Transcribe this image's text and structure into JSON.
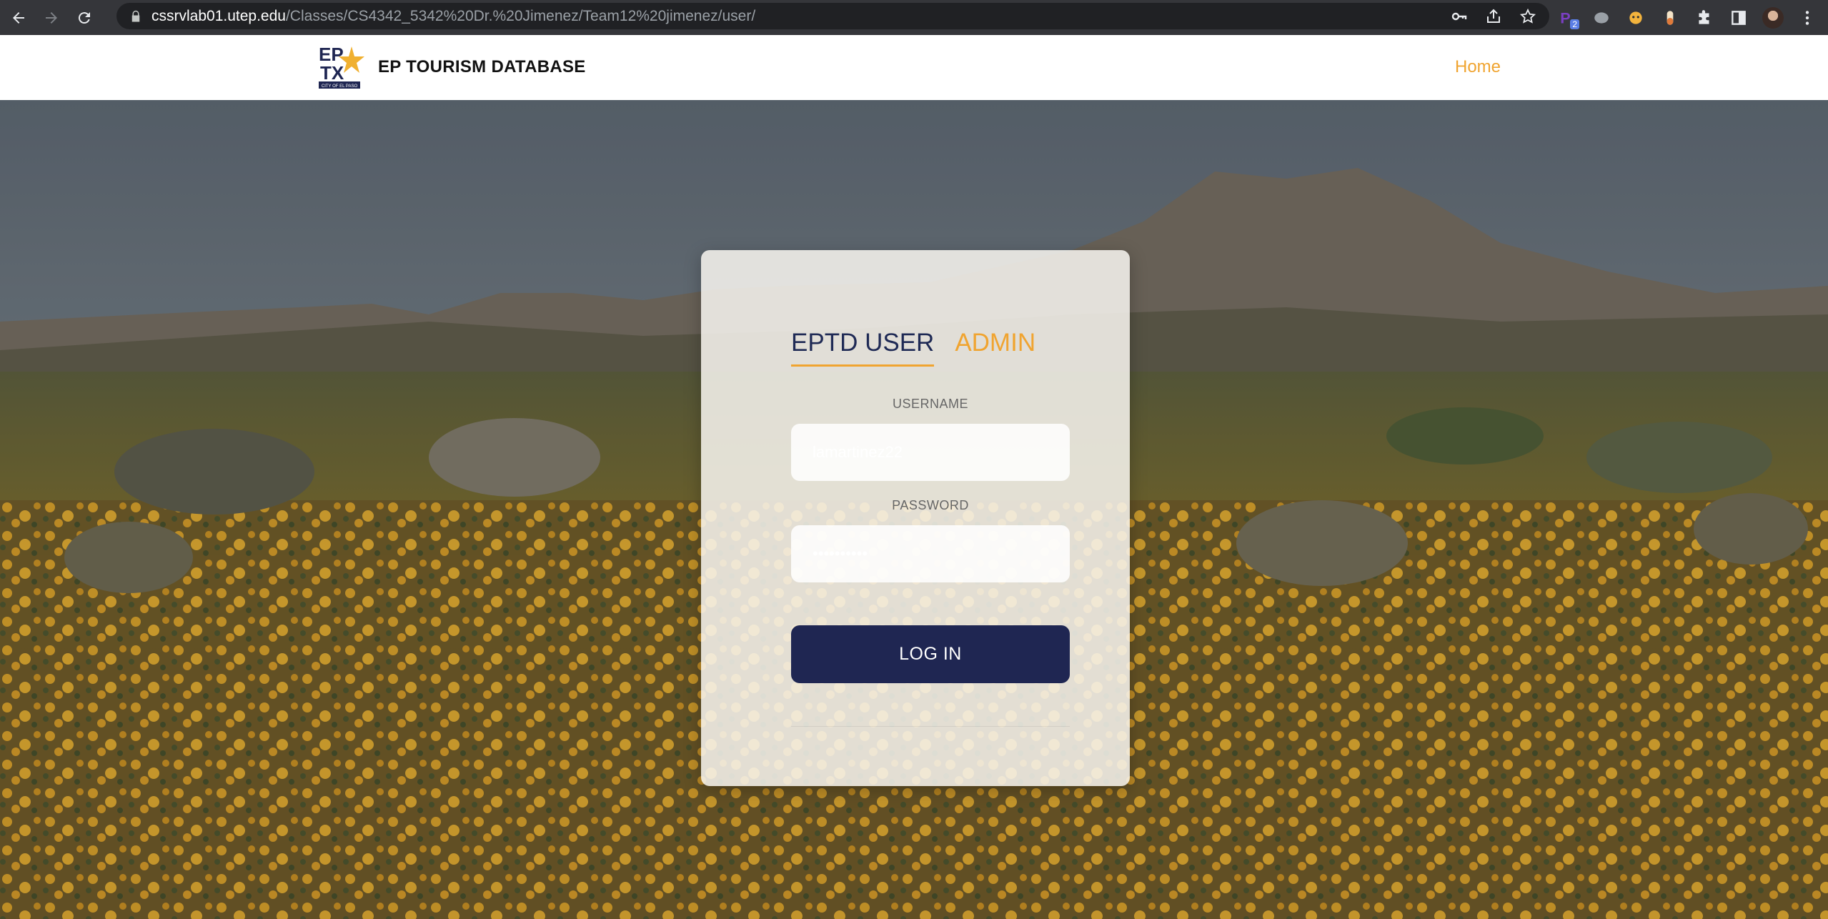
{
  "browser": {
    "url_host": "cssrvlab01.utep.edu",
    "url_path": "/Classes/CS4342_5342%20Dr.%20Jimenez/Team12%20jimenez/user/",
    "extension_badge": "2",
    "toolbar_icons": [
      "back-icon",
      "forward-icon",
      "reload-icon",
      "lock-icon",
      "key-icon",
      "share-icon",
      "star-icon",
      "extensions-icon",
      "side-panel-icon",
      "menu-icon"
    ]
  },
  "header": {
    "logo_text_top": "EP",
    "logo_text_bottom": "TX",
    "logo_caption": "CITY OF EL PASO",
    "site_title": "EP TOURISM DATABASE",
    "home_link": "Home"
  },
  "login": {
    "tabs": [
      {
        "label": "EPTD USER",
        "active": true
      },
      {
        "label": "ADMIN",
        "active": false
      }
    ],
    "username_label": "USERNAME",
    "username_value": "lamartinez22",
    "password_label": "PASSWORD",
    "password_value": "lamartinez",
    "submit_label": "LOG IN"
  },
  "colors": {
    "accent": "#f0a430",
    "primary": "#1f2652",
    "chrome": "#35363a"
  }
}
